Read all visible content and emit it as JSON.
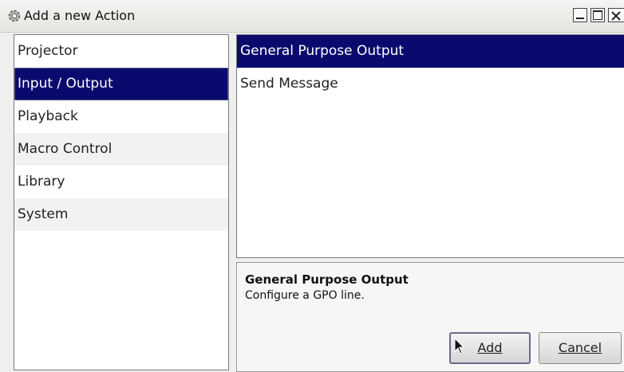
{
  "window": {
    "title": "Add a new Action"
  },
  "categories": [
    {
      "label": "Projector",
      "selected": false
    },
    {
      "label": "Input / Output",
      "selected": true
    },
    {
      "label": "Playback",
      "selected": false
    },
    {
      "label": "Macro Control",
      "selected": false
    },
    {
      "label": "Library",
      "selected": false
    },
    {
      "label": "System",
      "selected": false
    }
  ],
  "actions": [
    {
      "label": "General Purpose Output",
      "selected": true
    },
    {
      "label": "Send Message",
      "selected": false
    }
  ],
  "description": {
    "title": "General Purpose Output",
    "text": "Configure a GPO line."
  },
  "buttons": {
    "add": "Add",
    "cancel": "Cancel"
  },
  "colors": {
    "selection": "#0a0a6e",
    "accent_text": "#ffffff"
  },
  "icons": [
    "gear-icon",
    "minimize-icon",
    "maximize-icon",
    "close-icon",
    "mouse-cursor-icon"
  ]
}
